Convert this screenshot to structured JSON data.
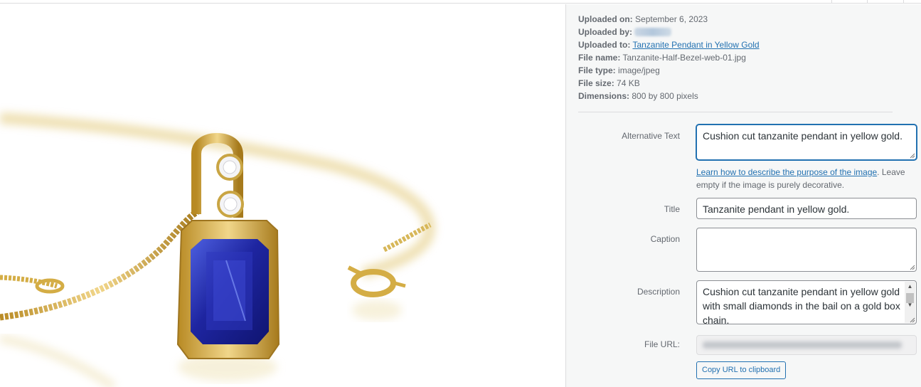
{
  "attachment": {
    "uploaded_on_label": "Uploaded on:",
    "uploaded_on": "September 6, 2023",
    "uploaded_by_label": "Uploaded by:",
    "uploaded_to_label": "Uploaded to:",
    "uploaded_to": "Tanzanite Pendant in Yellow Gold",
    "file_name_label": "File name:",
    "file_name": "Tanzanite-Half-Bezel-web-01.jpg",
    "file_type_label": "File type:",
    "file_type": "image/jpeg",
    "file_size_label": "File size:",
    "file_size": "74 KB",
    "dimensions_label": "Dimensions:",
    "dimensions": "800 by 800 pixels"
  },
  "form": {
    "alt_label": "Alternative Text",
    "alt_value": "Cushion cut tanzanite pendant in yellow gold.",
    "help_link": "Learn how to describe the purpose of the image",
    "help_rest": ". Leave empty if the image is purely decorative.",
    "title_label": "Title",
    "title_value": "Tanzanite pendant in yellow gold.",
    "caption_label": "Caption",
    "caption_value": "",
    "description_label": "Description",
    "description_value": "Cushion cut tanzanite pendant in yellow gold with small diamonds in the bail on a gold box chain.",
    "file_url_label": "File URL:",
    "copy_button": "Copy URL to clipboard"
  },
  "colors": {
    "link": "#2271b1",
    "focus": "#2271b1",
    "sidebar_bg": "#f6f7f7",
    "gold": "#d9b64a",
    "tanzanite": "#2a2fa8"
  },
  "icons": {
    "scroll_up": "▲",
    "scroll_down": "▼"
  }
}
